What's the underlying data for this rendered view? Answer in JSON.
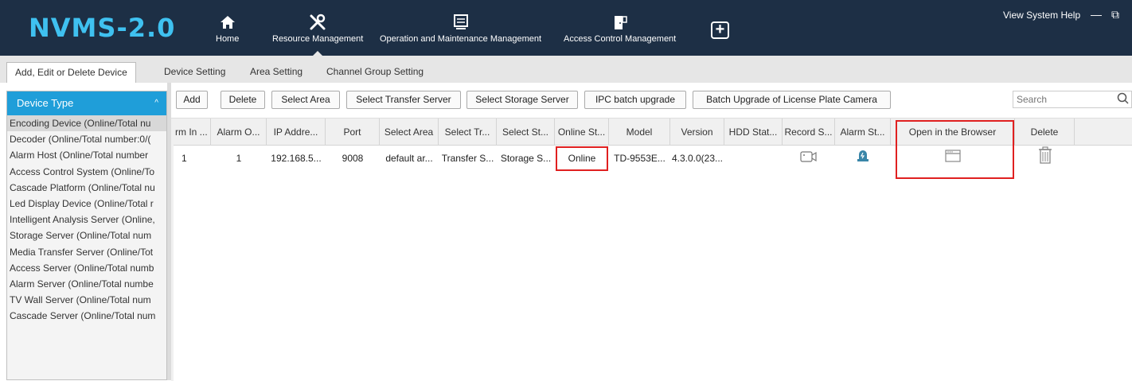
{
  "app": {
    "title": "NVMS-2.0"
  },
  "nav": {
    "home": "Home",
    "resource": "Resource Management",
    "operation": "Operation and Maintenance Management",
    "access": "Access Control Management",
    "add_icon": "plus-square-icon"
  },
  "system": {
    "menu": "View System Help",
    "minimize": "—",
    "restore": "⧉"
  },
  "tabs": [
    {
      "label": "Add, Edit or Delete Device",
      "active": true
    },
    {
      "label": "Device Setting"
    },
    {
      "label": "Area Setting"
    },
    {
      "label": "Channel Group Setting"
    }
  ],
  "device_type": {
    "header": "Device Type",
    "items": [
      "Encoding Device (Online/Total nu",
      "Decoder (Online/Total number:0/(",
      "Alarm Host (Online/Total number",
      "Access Control System (Online/To",
      "Cascade Platform (Online/Total nu",
      "Led Display Device (Online/Total r",
      "Intelligent Analysis Server (Online,",
      "Storage Server (Online/Total num",
      "Media Transfer Server (Online/Tot",
      "Access Server (Online/Total numb",
      "Alarm Server (Online/Total numbe",
      "TV Wall Server (Online/Total num",
      "Cascade Server (Online/Total num"
    ]
  },
  "toolbar": {
    "add": "Add",
    "delete": "Delete",
    "select_area": "Select Area",
    "select_transfer": "Select Transfer Server",
    "select_storage": "Select Storage Server",
    "ipc_upgrade": "IPC batch upgrade",
    "lpr_upgrade": "Batch Upgrade of License Plate Camera",
    "search_placeholder": "Search"
  },
  "table": {
    "headers": [
      "rm In ...",
      "Alarm O...",
      "IP Addre...",
      "Port",
      "Select Area",
      "Select Tr...",
      "Select St...",
      "Online St...",
      "Model",
      "Version",
      "HDD Stat...",
      "Record S...",
      "Alarm St...",
      "Open in the Browser",
      "Delete"
    ],
    "rows": [
      {
        "alarm_in": "1",
        "alarm_out": "1",
        "ip": "192.168.5...",
        "port": "9008",
        "area": "default ar...",
        "transfer": "Transfer S...",
        "storage": "Storage S...",
        "online": "Online",
        "model": "TD-9553E...",
        "version": "4.3.0.0(23...",
        "hdd": ""
      }
    ]
  },
  "colors": {
    "topbar": "#1d2f45",
    "logo": "#3fc1f0",
    "accent": "#1f9ed9",
    "highlight": "#e02020"
  }
}
